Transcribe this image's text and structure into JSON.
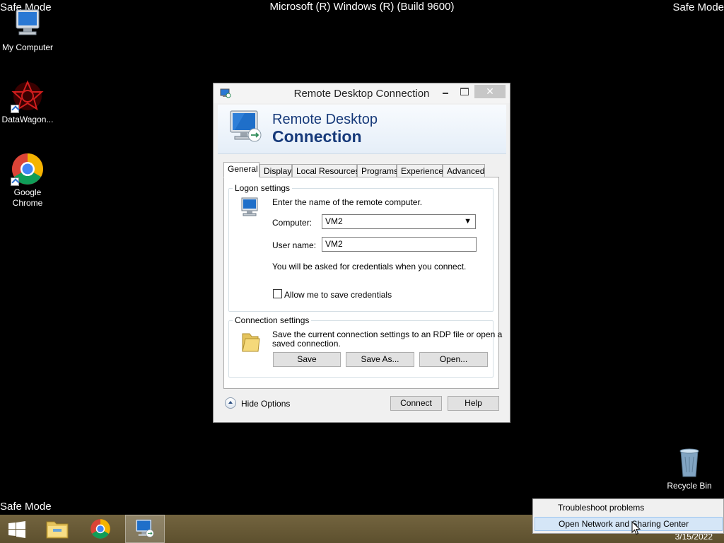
{
  "overlay": {
    "safe_mode": "Safe Mode",
    "build": "Microsoft (R) Windows (R) (Build 9600)"
  },
  "desktop": {
    "icons": [
      {
        "label": "My Computer",
        "icon": "computer-icon"
      },
      {
        "label": "DataWagon...",
        "icon": "datawagon-icon"
      },
      {
        "label": "Google Chrome",
        "icon": "chrome-icon"
      },
      {
        "label": "Recycle Bin",
        "icon": "recycle-bin-icon"
      }
    ]
  },
  "window": {
    "title": "Remote Desktop Connection",
    "close_glyph": "✕",
    "banner_line1": "Remote Desktop",
    "banner_line2": "Connection",
    "tabs": [
      "General",
      "Display",
      "Local Resources",
      "Programs",
      "Experience",
      "Advanced"
    ],
    "active_tab": "General",
    "logon": {
      "group_label": "Logon settings",
      "instructions": "Enter the name of the remote computer.",
      "computer_label": "Computer:",
      "computer_value": "VM2",
      "username_label": "User name:",
      "username_value": "VM2",
      "credentials_note": "You will be asked for credentials when you connect.",
      "save_credentials_label": "Allow me to save credentials",
      "save_credentials_checked": false
    },
    "connection": {
      "group_label": "Connection settings",
      "description_line1": "Save the current connection settings to an RDP file or open a",
      "description_line2": "saved connection.",
      "save_button": "Save",
      "save_as_button": "Save As...",
      "open_button": "Open..."
    },
    "hide_options": "Hide Options",
    "connect_button": "Connect",
    "help_button": "Help"
  },
  "taskbar": {
    "items": [
      "start-button",
      "file-explorer",
      "google-chrome",
      "remote-desktop-connection"
    ],
    "date": "3/15/2022"
  },
  "context_menu": {
    "items": [
      "Troubleshoot problems",
      "Open Network and Sharing Center"
    ],
    "hovered_index": 1
  },
  "colors": {
    "taskbar": "#6b5c36",
    "banner_text": "#173a7a",
    "menu_hover": "#d5e6f7"
  }
}
